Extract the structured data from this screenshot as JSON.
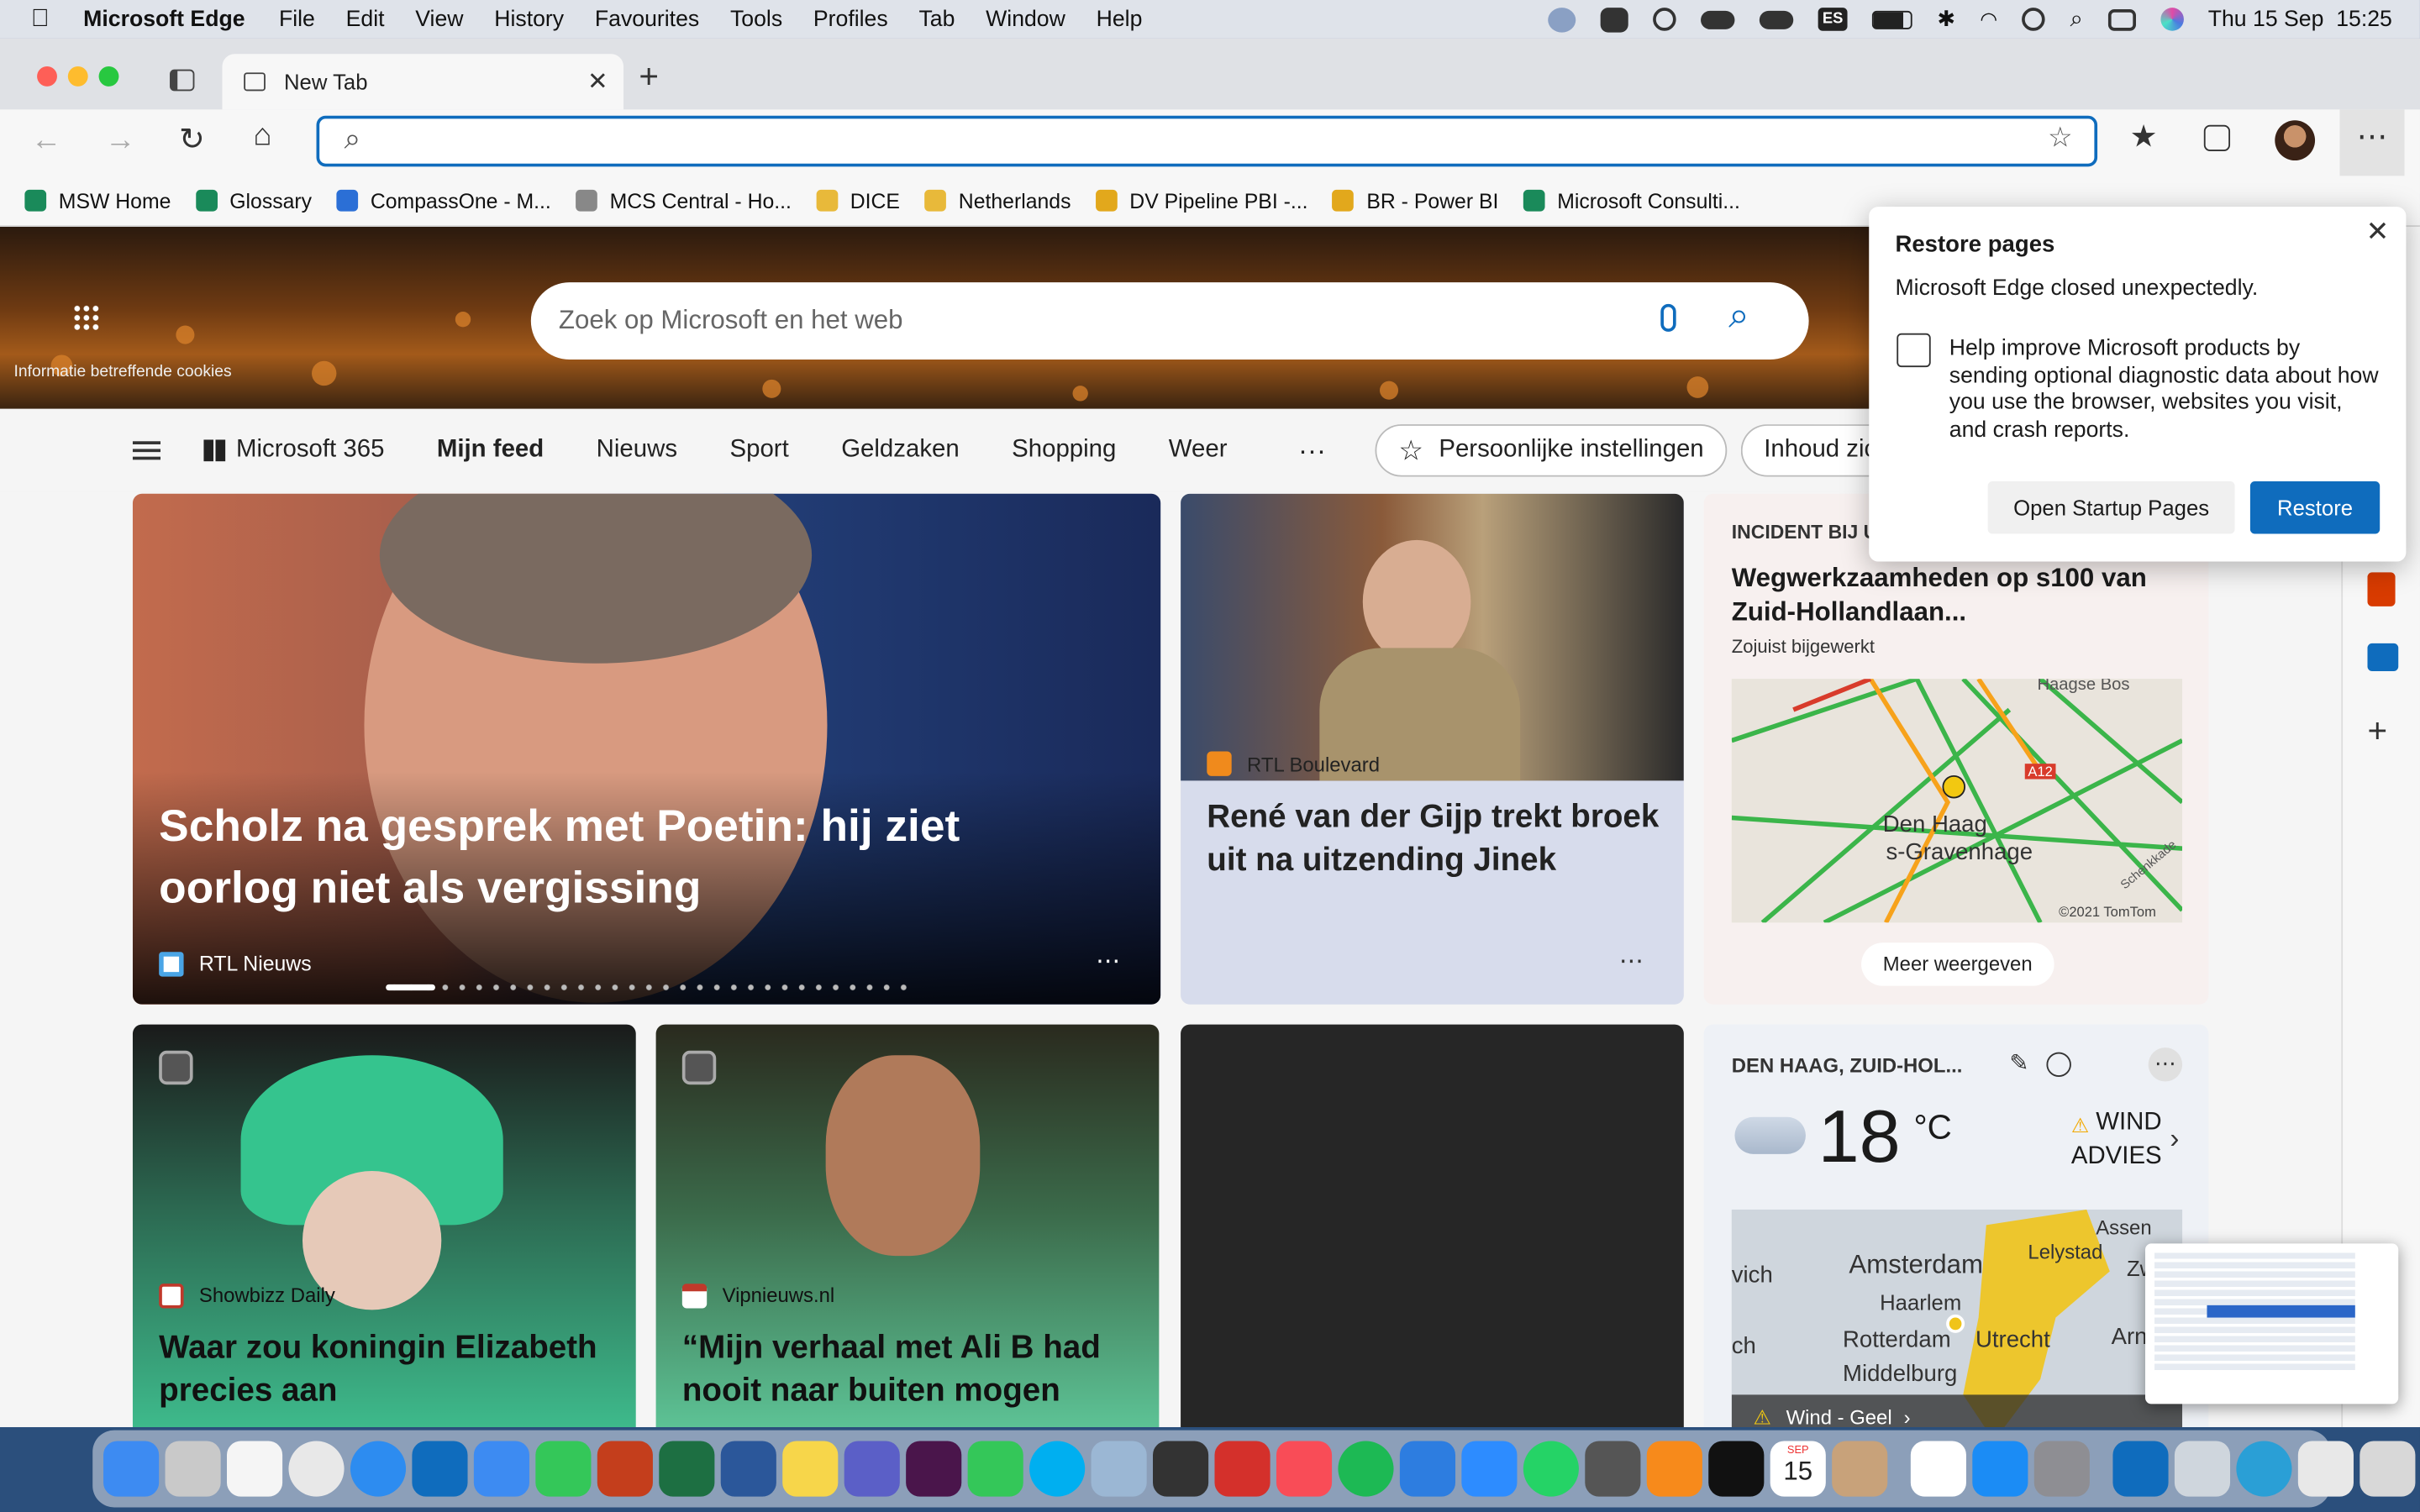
{
  "menubar": {
    "app": "Microsoft Edge",
    "items": [
      "File",
      "Edit",
      "View",
      "History",
      "Favourites",
      "Tools",
      "Profiles",
      "Tab",
      "Window",
      "Help"
    ],
    "input_badge": "ES",
    "clock": "Thu 15 Sep  15:25"
  },
  "tab": {
    "title": "New Tab"
  },
  "address": {
    "value": "",
    "placeholder": ""
  },
  "favourites": [
    {
      "label": "MSW Home",
      "color": "#1a8a5a"
    },
    {
      "label": "Glossary",
      "color": "#1a8a5a"
    },
    {
      "label": "CompassOne - M...",
      "color": "#2b6fd6"
    },
    {
      "label": "MCS Central - Ho...",
      "color": "#888888"
    },
    {
      "label": "DICE",
      "color": "#e8b93a"
    },
    {
      "label": "Netherlands",
      "color": "#e8b93a"
    },
    {
      "label": "DV Pipeline PBI -...",
      "color": "#e2a81c"
    },
    {
      "label": "BR - Power BI",
      "color": "#e2a81c"
    },
    {
      "label": "Microsoft Consulti...",
      "color": "#1a8a5a"
    }
  ],
  "hero": {
    "cookie_text": "Informatie betreffende cookies",
    "search_placeholder": "Zoek op Microsoft en het web"
  },
  "nav": {
    "items": [
      "Microsoft 365",
      "Mijn feed",
      "Nieuws",
      "Sport",
      "Geldzaken",
      "Shopping",
      "Weer"
    ],
    "more": "···",
    "personal": "Persoonlijke instellingen",
    "visibility": "Inhoud zichtba"
  },
  "cards": {
    "main": {
      "headline": "Scholz na gesprek met Poetin: hij ziet oorlog niet als vergissing",
      "source": "RTL Nieuws"
    },
    "second": {
      "headline": "René van der Gijp trekt broek uit na uitzending Jinek",
      "source": "RTL Boulevard"
    },
    "incident": {
      "tag": "INCIDENT BIJ U IN DE BUURT",
      "title": "Wegwerkzaamheden op s100 van Zuid-Hollandlaan...",
      "updated": "Zojuist bijgewerkt",
      "map_labels": [
        "Haagse Bos",
        "Den Haag",
        "s-Gravenhage",
        "A12",
        "Schenkkade"
      ],
      "credit": "©2021 TomTom",
      "more": "Meer weergeven"
    },
    "queen": {
      "source": "Showbizz Daily",
      "headline": "Waar zou koningin Elizabeth precies aan"
    },
    "vip": {
      "source": "Vipnieuws.nl",
      "headline": "“Mijn verhaal met Ali B had nooit naar buiten mogen"
    },
    "weather": {
      "location": "DEN HAAG, ZUID-HOL...",
      "temp": "18",
      "unit": "°C",
      "alert_line1": "WIND",
      "alert_line2": "ADVIES",
      "map_labels": [
        "Amsterdam",
        "Haarlem",
        "Rotterdam",
        "Utrecht",
        "Lelystad",
        "Zwo",
        "Arnhe",
        "Assen",
        "Middelburg",
        "vich",
        "ch"
      ],
      "footer": "Wind - Geel"
    }
  },
  "popup": {
    "title": "Restore pages",
    "message": "Microsoft Edge closed unexpectedly.",
    "checkbox_label": "Help improve Microsoft products by sending optional diagnostic data about how you use the browser, websites you visit, and crash reports.",
    "btn_open": "Open Startup Pages",
    "btn_restore": "Restore"
  },
  "colors": {
    "accent": "#0f6cbd",
    "tab_bg": "#dfe1e5",
    "hero_dark": "#2b1a0e"
  },
  "dock": [
    "finder",
    "launchpad",
    "photos",
    "chrome",
    "safari",
    "outlook",
    "mail",
    "messages",
    "powerpoint",
    "excel",
    "word",
    "notes",
    "teams",
    "slack",
    "facetime",
    "skype",
    "preview",
    "quicktime",
    "pdf",
    "music",
    "spotify",
    "keynote",
    "zoom",
    "whatsapp",
    "calculator",
    "vlc",
    "appletv",
    "calendar",
    "contacts",
    "reminders",
    "appstore",
    "settings",
    "outlook2",
    "screenshot",
    "edge",
    "files",
    "trash"
  ],
  "dock_calendar": {
    "month": "SEP",
    "day": "15"
  }
}
